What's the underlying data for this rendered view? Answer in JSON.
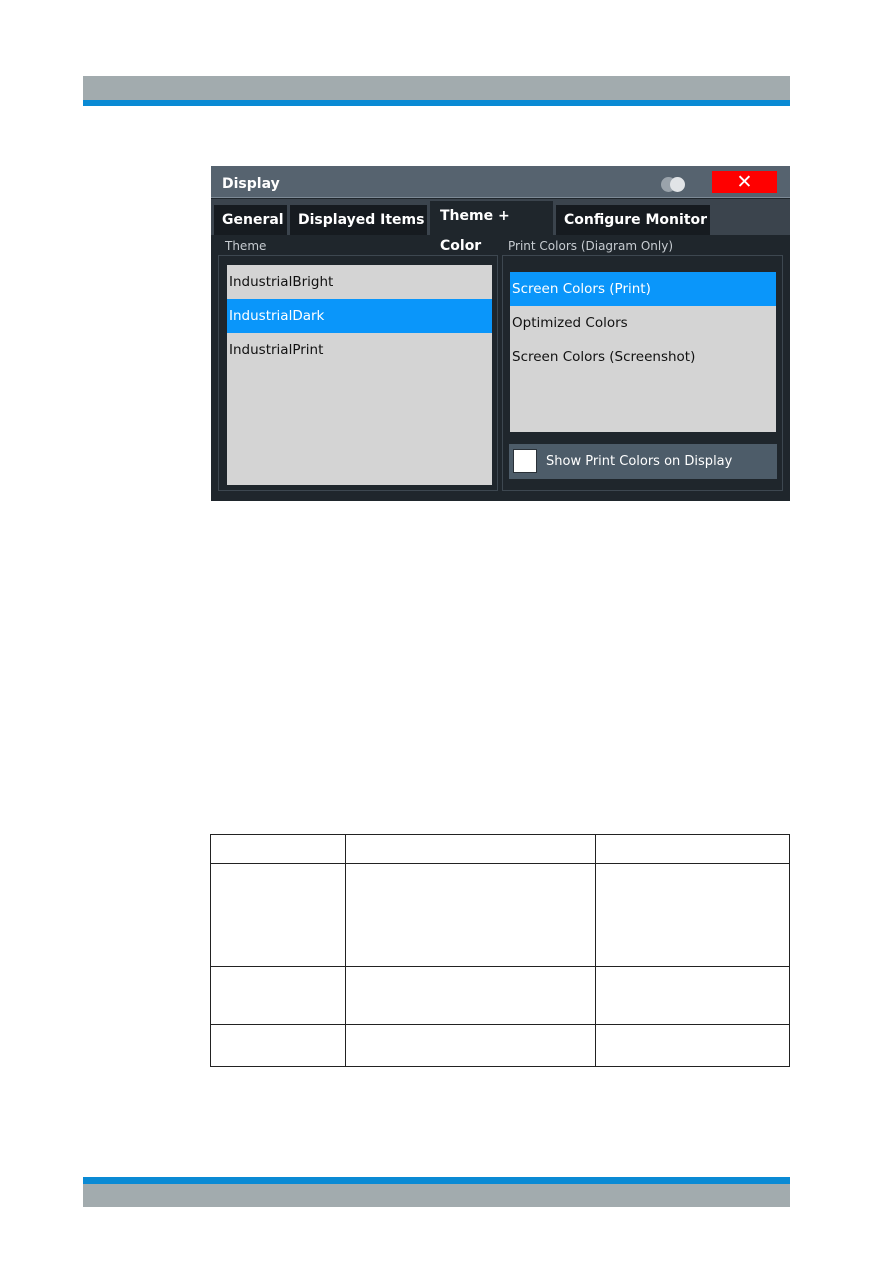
{
  "page": {
    "header_band_color": "#a2abae",
    "accent_line_color": "#0a8ad4"
  },
  "dialog": {
    "title": "Display",
    "toggle_icon": "display-toggle-icon",
    "close_label": "✕",
    "close_color": "#ff0000",
    "tabs": [
      {
        "label": "General",
        "active": false
      },
      {
        "label": "Displayed Items",
        "active": false
      },
      {
        "label": "Theme + Color",
        "active": true
      },
      {
        "label": "Configure Monitor",
        "active": false
      }
    ],
    "theme": {
      "label": "Theme",
      "items": [
        {
          "label": "IndustrialBright",
          "selected": false
        },
        {
          "label": "IndustrialDark",
          "selected": true
        },
        {
          "label": "IndustrialPrint",
          "selected": false
        }
      ]
    },
    "print_colors": {
      "label": "Print Colors (Diagram Only)",
      "items": [
        {
          "label": "Screen Colors (Print)",
          "selected": true
        },
        {
          "label": "Optimized Colors",
          "selected": false
        },
        {
          "label": "Screen Colors (Screenshot)",
          "selected": false
        }
      ],
      "show_on_display": {
        "label": "Show Print Colors on Display",
        "checked": false
      }
    },
    "selection_color": "#0a96fa"
  },
  "table": {
    "rows": [
      [
        "",
        "",
        ""
      ],
      [
        "",
        "",
        ""
      ],
      [
        "",
        "",
        ""
      ],
      [
        "",
        "",
        ""
      ]
    ]
  }
}
